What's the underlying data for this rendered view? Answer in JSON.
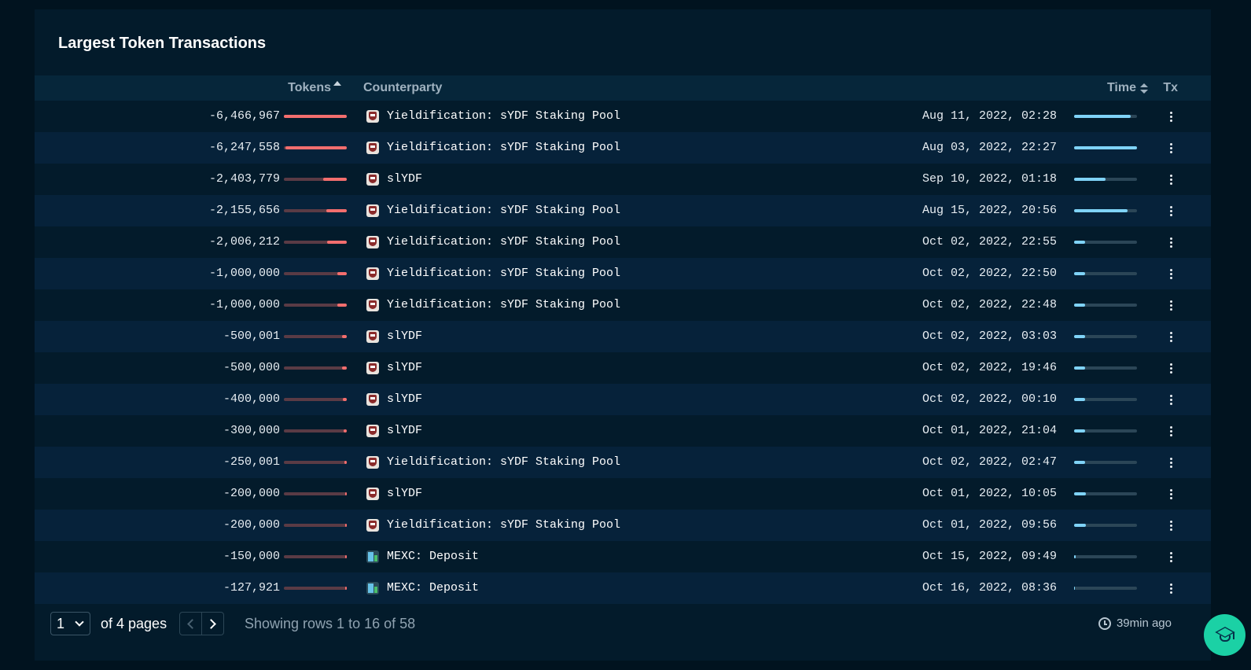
{
  "panel": {
    "title": "Largest Token Transactions"
  },
  "table": {
    "columns": {
      "tokens": "Tokens",
      "counterparty": "Counterparty",
      "time": "Time",
      "tx": "Tx"
    },
    "rows": [
      {
        "tokens": "-6,466,967",
        "token_bar": 1.0,
        "counterparty": "Yieldification: sYDF Staking Pool",
        "icon": "shield-icon",
        "time": "Aug 11, 2022, 02:28",
        "time_bar": 0.9
      },
      {
        "tokens": "-6,247,558",
        "token_bar": 0.97,
        "counterparty": "Yieldification: sYDF Staking Pool",
        "icon": "shield-icon",
        "time": "Aug 03, 2022, 22:27",
        "time_bar": 1.0
      },
      {
        "tokens": "-2,403,779",
        "token_bar": 0.37,
        "counterparty": "slYDF",
        "icon": "shield-icon",
        "time": "Sep 10, 2022, 01:18",
        "time_bar": 0.5
      },
      {
        "tokens": "-2,155,656",
        "token_bar": 0.33,
        "counterparty": "Yieldification: sYDF Staking Pool",
        "icon": "shield-icon",
        "time": "Aug 15, 2022, 20:56",
        "time_bar": 0.85
      },
      {
        "tokens": "-2,006,212",
        "token_bar": 0.31,
        "counterparty": "Yieldification: sYDF Staking Pool",
        "icon": "shield-icon",
        "time": "Oct 02, 2022, 22:55",
        "time_bar": 0.17
      },
      {
        "tokens": "-1,000,000",
        "token_bar": 0.155,
        "counterparty": "Yieldification: sYDF Staking Pool",
        "icon": "shield-icon",
        "time": "Oct 02, 2022, 22:50",
        "time_bar": 0.17
      },
      {
        "tokens": "-1,000,000",
        "token_bar": 0.155,
        "counterparty": "Yieldification: sYDF Staking Pool",
        "icon": "shield-icon",
        "time": "Oct 02, 2022, 22:48",
        "time_bar": 0.17
      },
      {
        "tokens": "-500,001",
        "token_bar": 0.077,
        "counterparty": "slYDF",
        "icon": "shield-icon",
        "time": "Oct 02, 2022, 03:03",
        "time_bar": 0.18
      },
      {
        "tokens": "-500,000",
        "token_bar": 0.077,
        "counterparty": "slYDF",
        "icon": "shield-icon",
        "time": "Oct 02, 2022, 19:46",
        "time_bar": 0.17
      },
      {
        "tokens": "-400,000",
        "token_bar": 0.062,
        "counterparty": "slYDF",
        "icon": "shield-icon",
        "time": "Oct 02, 2022, 00:10",
        "time_bar": 0.18
      },
      {
        "tokens": "-300,000",
        "token_bar": 0.046,
        "counterparty": "slYDF",
        "icon": "shield-icon",
        "time": "Oct 01, 2022, 21:04",
        "time_bar": 0.18
      },
      {
        "tokens": "-250,001",
        "token_bar": 0.039,
        "counterparty": "Yieldification: sYDF Staking Pool",
        "icon": "shield-icon",
        "time": "Oct 02, 2022, 02:47",
        "time_bar": 0.18
      },
      {
        "tokens": "-200,000",
        "token_bar": 0.031,
        "counterparty": "slYDF",
        "icon": "shield-icon",
        "time": "Oct 01, 2022, 10:05",
        "time_bar": 0.19
      },
      {
        "tokens": "-200,000",
        "token_bar": 0.031,
        "counterparty": "Yieldification: sYDF Staking Pool",
        "icon": "shield-icon",
        "time": "Oct 01, 2022, 09:56",
        "time_bar": 0.19
      },
      {
        "tokens": "-150,000",
        "token_bar": 0.023,
        "counterparty": "MEXC: Deposit",
        "icon": "building-icon",
        "time": "Oct 15, 2022, 09:49",
        "time_bar": 0.02
      },
      {
        "tokens": "-127,921",
        "token_bar": 0.02,
        "counterparty": "MEXC: Deposit",
        "icon": "building-icon",
        "time": "Oct 16, 2022, 08:36",
        "time_bar": 0.01
      }
    ]
  },
  "pagination": {
    "current_page": "1",
    "of_pages": "of 4 pages",
    "showing": "Showing rows 1 to 16 of 58"
  },
  "status": {
    "updated": "39min ago"
  },
  "colors": {
    "token_bar_fill": "#f36e6e",
    "time_bar_fill": "#7fd3f7",
    "fab_bg": "#1bd1a5"
  }
}
